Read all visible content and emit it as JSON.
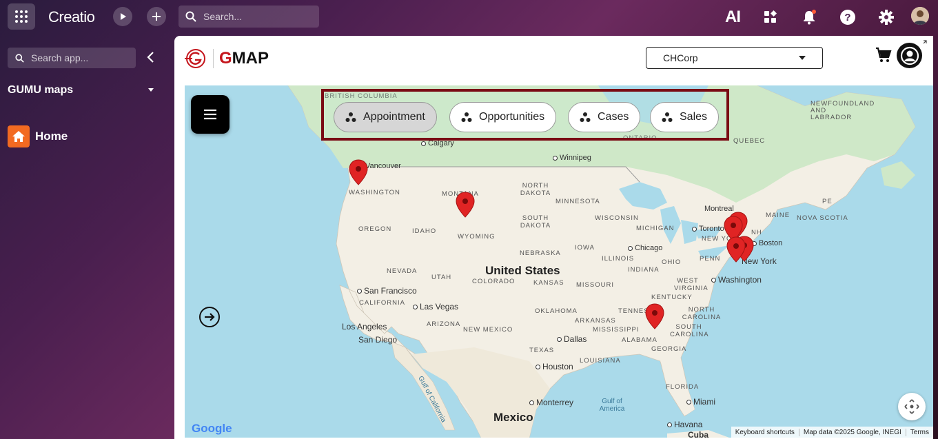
{
  "topbar": {
    "logo": "Creatio",
    "search_placeholder": "Search...",
    "ai_label": "AI",
    "icons": [
      "apps-grid-icon",
      "play-icon",
      "plus-icon",
      "search-icon",
      "ai-icon",
      "widgets-icon",
      "bell-icon",
      "help-icon",
      "gear-icon",
      "avatar"
    ]
  },
  "sidebar": {
    "search_placeholder": "Search app...",
    "section_title": "GUMU maps",
    "items": [
      {
        "label": "Home",
        "icon": "home-icon"
      }
    ]
  },
  "app": {
    "brand_g": "G",
    "brand_rest": "MAP",
    "company_select": "CHCorp"
  },
  "filters": [
    {
      "label": "Appointment",
      "active": true
    },
    {
      "label": "Opportunities",
      "active": false
    },
    {
      "label": "Cases",
      "active": false
    },
    {
      "label": "Sales",
      "active": false
    }
  ],
  "map": {
    "labels": {
      "british_columbia": "BRITISH COLUMBIA",
      "calgary": "Calgary",
      "vancouver": "Vancouver",
      "winnipeg": "Winnipeg",
      "ontario": "ONTARIO",
      "quebec": "QUEBEC",
      "newfoundland": "NEWFOUNDLAND AND LABRADOR",
      "washington": "WASHINGTON",
      "montana": "MONTANA",
      "north_dakota": "NORTH DAKOTA",
      "minnesota": "MINNESOTA",
      "oregon": "OREGON",
      "idaho": "IDAHO",
      "south_dakota": "SOUTH DAKOTA",
      "wisconsin": "WISCONSIN",
      "michigan": "MICHIGAN",
      "wyoming": "WYOMING",
      "montreal": "Montreal",
      "toronto": "Toronto",
      "maine": "MAINE",
      "pe": "PE",
      "nova_scotia": "NOVA SCOTIA",
      "nh": "NH",
      "iowa": "IOWA",
      "nebraska": "NEBRASKA",
      "chicago": "Chicago",
      "illinois": "ILLINOIS",
      "new_york_state": "NEW YO",
      "boston": "Boston",
      "nevada": "NEVADA",
      "utah": "UTAH",
      "united_states": "United States",
      "colorado": "COLORADO",
      "kansas": "KANSAS",
      "missouri": "MISSOURI",
      "indiana": "INDIANA",
      "ohio": "OHIO",
      "penn": "PENN",
      "new_york": "New York",
      "san_francisco": "San Francisco",
      "west_virginia": "WEST VIRGINIA",
      "washington_dc": "Washington",
      "california": "CALIFORNIA",
      "las_vegas": "Las Vegas",
      "kentucky": "KENTUCKY",
      "tennessee": "TENNESSEE",
      "north_carolina": "NORTH CAROLINA",
      "arizona": "ARIZONA",
      "los_angeles": "Los Angeles",
      "oklahoma": "OKLAHOMA",
      "arkansas": "ARKANSAS",
      "new_mexico": "NEW MEXICO",
      "south_carolina": "SOUTH CAROLINA",
      "san_diego": "San Diego",
      "dallas": "Dallas",
      "mississippi": "MISSISSIPPI",
      "alabama": "ALABAMA",
      "georgia": "GEORGIA",
      "texas": "TEXAS",
      "houston": "Houston",
      "louisiana": "LOUISIANA",
      "gulf_of_california": "Gulf of California",
      "florida": "FLORIDA",
      "monterrey": "Monterrey",
      "gulf_of_america": "Gulf of America",
      "miami": "Miami",
      "mexico": "Mexico",
      "havana": "Havana",
      "cuba": "Cuba"
    },
    "footer": {
      "google": "Google",
      "keyboard_shortcuts": "Keyboard shortcuts",
      "map_data": "Map data ©2025 Google, INEGI",
      "terms": "Terms"
    }
  },
  "colors": {
    "brand_red": "#c5161d",
    "pin_red": "#e02424",
    "filter_border": "#7a0a14",
    "home_orange": "#f26a21"
  }
}
